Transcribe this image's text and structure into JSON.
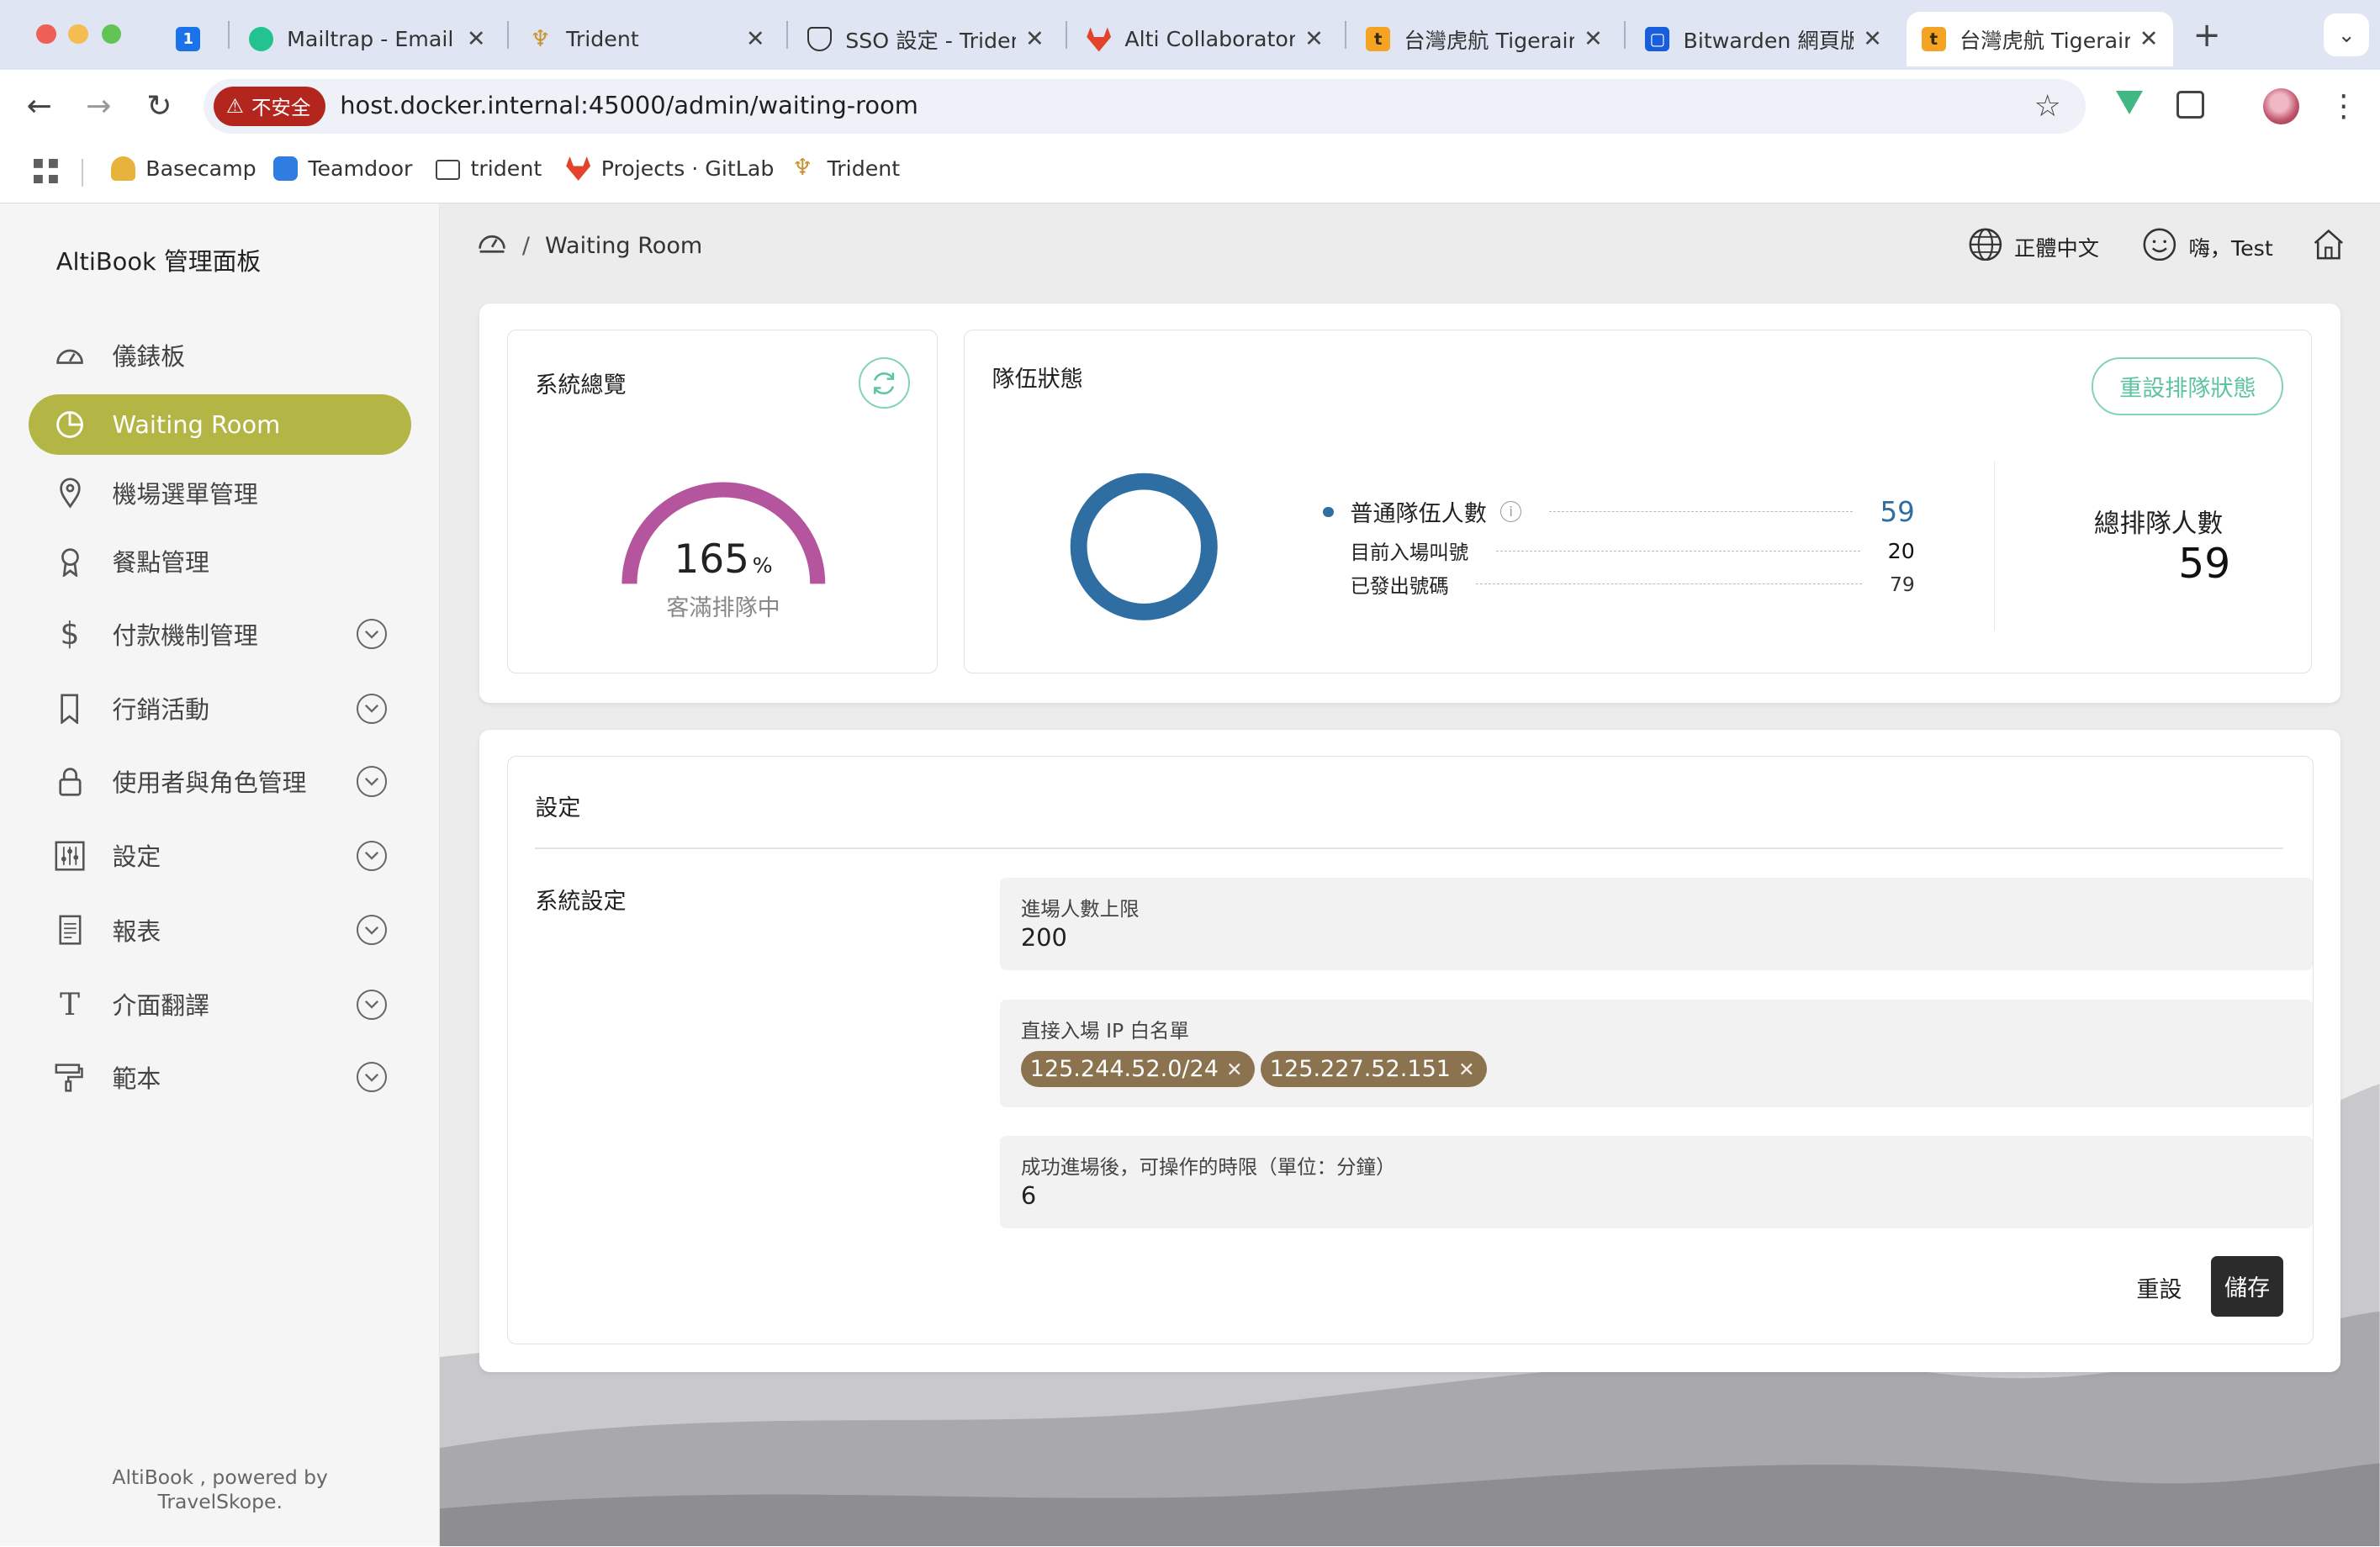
{
  "browser": {
    "tabs": [
      {
        "title": "",
        "icon": "calendar-icon"
      },
      {
        "title": "Mailtrap - Email Delivery",
        "icon": "mailtrap-icon"
      },
      {
        "title": "Trident",
        "icon": "trident-icon"
      },
      {
        "title": "SSO 設定 - Trident",
        "icon": "shield-icon"
      },
      {
        "title": "Alti Collaborator",
        "icon": "gitlab-icon"
      },
      {
        "title": "台灣虎航 Tigerair",
        "icon": "tigerair-icon"
      },
      {
        "title": "Bitwarden 網頁版",
        "icon": "bitwarden-icon"
      },
      {
        "title": "台灣虎航 Tigerair",
        "icon": "tigerair-icon"
      }
    ],
    "insecure_label": "不安全",
    "url": "host.docker.internal:45000/admin/waiting-room",
    "bookmarks": [
      {
        "label": "Basecamp",
        "icon": "basecamp-icon"
      },
      {
        "label": "Teamdoor",
        "icon": "teamdoor-icon"
      },
      {
        "label": "trident",
        "icon": "folder-icon"
      },
      {
        "label": "Projects · GitLab",
        "icon": "gitlab-icon"
      },
      {
        "label": "Trident",
        "icon": "trident-icon"
      }
    ]
  },
  "sidebar": {
    "brand": "AltiBook 管理面板",
    "items": [
      {
        "label": "儀錶板",
        "icon": "dashboard-icon"
      },
      {
        "label": "Waiting Room",
        "icon": "pie-chart-icon"
      },
      {
        "label": "機場選單管理",
        "icon": "location-pin-icon"
      },
      {
        "label": "餐點管理",
        "icon": "award-icon"
      },
      {
        "label": "付款機制管理",
        "icon": "dollar-icon"
      },
      {
        "label": "行銷活動",
        "icon": "bookmark-icon"
      },
      {
        "label": "使用者與角色管理",
        "icon": "lock-icon"
      },
      {
        "label": "設定",
        "icon": "sliders-icon"
      },
      {
        "label": "報表",
        "icon": "report-icon"
      },
      {
        "label": "介面翻譯",
        "icon": "text-icon"
      },
      {
        "label": "範本",
        "icon": "paint-roller-icon"
      }
    ],
    "footer_line1": "AltiBook , powered by",
    "footer_line2": "TravelSkope."
  },
  "header": {
    "breadcrumb_current": "Waiting Room",
    "language": "正體中文",
    "greeting": "嗨，Test"
  },
  "overview": {
    "title": "系統總覽",
    "gauge_value": "165",
    "gauge_unit": "%",
    "gauge_percent": 165,
    "gauge_status": "客滿排隊中",
    "gauge_color": "#b4559e"
  },
  "queue": {
    "title": "隊伍狀態",
    "reset_button": "重設排隊狀態",
    "ring_color": "#2f6ea3",
    "regular_label": "普通隊伍人數",
    "regular_value": "59",
    "current_label": "目前入場叫號",
    "current_value": "20",
    "issued_label": "已發出號碼",
    "issued_value": "79",
    "total_label": "總排隊人數",
    "total_value": "59"
  },
  "settings": {
    "title": "設定",
    "section": "系統設定",
    "max_entry_label": "進場人數上限",
    "max_entry_value": "200",
    "whitelist_label": "直接入場 IP 白名單",
    "whitelist": [
      "125.244.52.0/24",
      "125.227.52.151"
    ],
    "time_limit_label": "成功進場後，可操作的時限（單位：分鐘）",
    "time_limit_value": "6",
    "reset_button": "重設",
    "save_button": "儲存"
  },
  "colors": {
    "accent": "#b3b545",
    "chip": "#8b7350",
    "insecure": "#b3261e"
  }
}
